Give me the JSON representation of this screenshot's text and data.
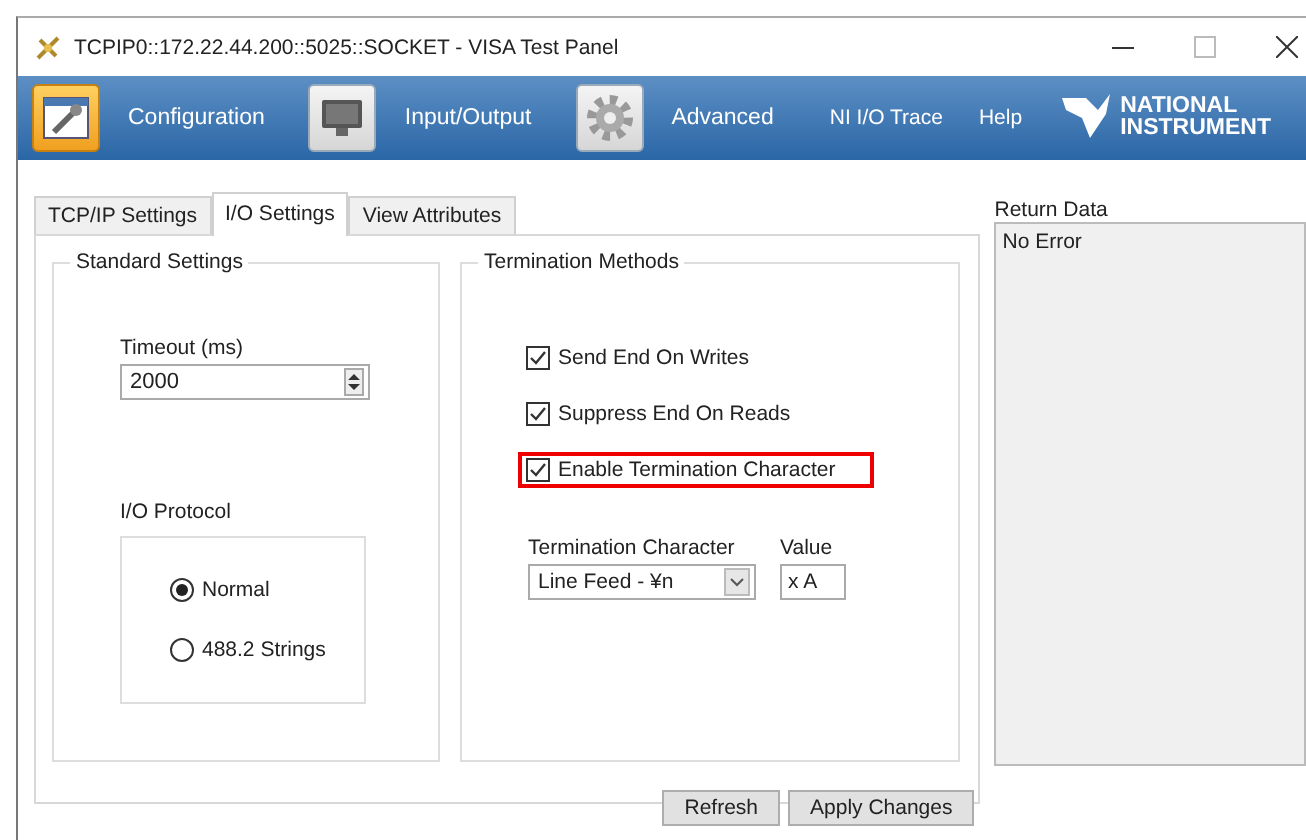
{
  "window": {
    "title": "TCPIP0::172.22.44.200::5025::SOCKET - VISA Test Panel"
  },
  "toolbar": {
    "items": [
      {
        "label": "Configuration",
        "kind": "config",
        "selected": true
      },
      {
        "label": "Input/Output",
        "kind": "monitor",
        "selected": false
      },
      {
        "label": "Advanced",
        "kind": "gear",
        "selected": false
      }
    ],
    "links": [
      "NI I/O Trace",
      "Help"
    ],
    "logo": [
      "NATIONAL",
      "INSTRUMENT"
    ]
  },
  "tabs": [
    {
      "label": "TCP/IP Settings",
      "selected": false
    },
    {
      "label": "I/O Settings",
      "selected": true
    },
    {
      "label": "View Attributes",
      "selected": false
    }
  ],
  "standard_settings": {
    "title": "Standard Settings",
    "timeout": {
      "label": "Timeout (ms)",
      "value": "2000"
    },
    "protocol": {
      "label": "I/O Protocol",
      "options": [
        {
          "label": "Normal",
          "selected": true
        },
        {
          "label": "488.2 Strings",
          "selected": false
        }
      ]
    }
  },
  "termination": {
    "title": "Termination Methods",
    "checkboxes": [
      {
        "label": "Send End On Writes",
        "checked": true,
        "highlighted": false
      },
      {
        "label": "Suppress End On Reads",
        "checked": true,
        "highlighted": false
      },
      {
        "label": "Enable Termination Character",
        "checked": true,
        "highlighted": true
      }
    ],
    "character": {
      "label": "Termination Character",
      "value": "Line Feed - ¥n"
    },
    "value": {
      "label": "Value",
      "value": "x A"
    }
  },
  "return_data": {
    "label": "Return Data",
    "text": "No Error"
  },
  "buttons": [
    "Refresh",
    "Apply Changes"
  ]
}
